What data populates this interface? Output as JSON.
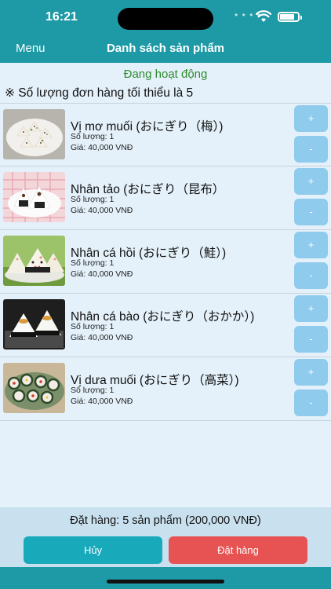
{
  "status_bar": {
    "time": "16:21",
    "dots": "• • • •"
  },
  "nav": {
    "menu_label": "Menu",
    "title": "Danh sách sản phẩm"
  },
  "status_text": "Đang hoạt động",
  "note": "※ Số lượng đơn hàng tối thiểu là 5",
  "products": [
    {
      "name": "Vị mơ muối (おにぎり（梅）)",
      "qty": "Số lượng: 1",
      "price": "Giá: 40,000 VNĐ",
      "plus": "+",
      "minus": "-"
    },
    {
      "name": "Nhân tảo (おにぎり（昆布）",
      "qty": "Số lượng: 1",
      "price": "Giá: 40,000 VNĐ",
      "plus": "+",
      "minus": "-"
    },
    {
      "name": "Nhân cá hồi (おにぎり（鮭）)",
      "qty": "Số lượng: 1",
      "price": "Giá: 40,000 VNĐ",
      "plus": "+",
      "minus": "-"
    },
    {
      "name": "Nhân cá bào (おにぎり（おかか）)",
      "qty": "Số lượng: 1",
      "price": "Giá: 40,000 VNĐ",
      "plus": "+",
      "minus": "-"
    },
    {
      "name": "Vị dưa muối (おにぎり（高菜）)",
      "qty": "Số lượng: 1",
      "price": "Giá: 40,000 VNĐ",
      "plus": "+",
      "minus": "-"
    }
  ],
  "footer": {
    "summary": "Đặt hàng: 5 sản phẩm (200,000 VNĐ)",
    "cancel_label": "Hủy",
    "order_label": "Đặt hàng"
  },
  "colors": {
    "teal": "#1d9aa6",
    "content_bg": "#e4f1fa",
    "status_green": "#2e8b2e",
    "stepper_blue": "#8fcbed",
    "cancel_teal": "#18a9bb",
    "order_red": "#e65352"
  }
}
